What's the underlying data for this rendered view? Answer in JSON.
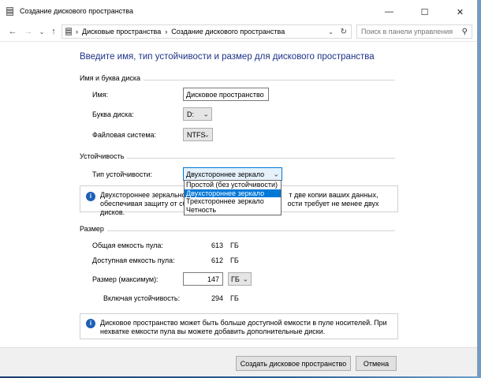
{
  "window": {
    "title": "Создание дискового пространства"
  },
  "controls": {
    "minimize": "—",
    "maximize": "☐",
    "close": "✕"
  },
  "breadcrumb": {
    "root": "Дисковые пространства",
    "sep": "›",
    "current": "Создание дискового пространства"
  },
  "search": {
    "placeholder": "Поиск в панели управления"
  },
  "heading": "Введите имя, тип устойчивости и размер для дискового пространства",
  "name_section": {
    "title": "Имя и буква диска",
    "name_label": "Имя:",
    "name_value": "Дисковое пространство",
    "letter_label": "Буква диска:",
    "letter_value": "D:",
    "fs_label": "Файловая система:",
    "fs_value": "NTFS"
  },
  "resiliency": {
    "title": "Устойчивость",
    "type_label": "Тип устойчивости:",
    "type_value": "Двухстороннее зеркало",
    "info_line1_a": "Двухстороннее зеркальное д",
    "info_line1_b": "т две копии ваших данных,",
    "info_line2_a": "обеспечивая защиту от сбоя",
    "info_line2_b": "ости требует не менее двух дисков.",
    "options": [
      "Простой (без устойчивости)",
      "Двухстороннее зеркало",
      "Трехстороннее зеркало",
      "Четность"
    ],
    "selected_index": 1
  },
  "size": {
    "title": "Размер",
    "total_label": "Общая емкость пула:",
    "total_value": "613",
    "total_unit": "ГБ",
    "avail_label": "Доступная емкость пула:",
    "avail_value": "612",
    "avail_unit": "ГБ",
    "max_label": "Размер (максимум):",
    "max_value": "147",
    "max_unit": "ГБ",
    "incl_label": "Включая устойчивость:",
    "incl_value": "294",
    "incl_unit": "ГБ",
    "info": "Дисковое пространство может быть больше доступной емкости в пуле носителей. При нехватке емкости пула вы можете добавить дополнительные диски."
  },
  "buttons": {
    "create": "Создать дисковое пространство",
    "cancel": "Отмена"
  },
  "colors": {
    "heading": "#1e3287",
    "accent": "#0078d7",
    "info_icon": "#1f5fb5"
  }
}
